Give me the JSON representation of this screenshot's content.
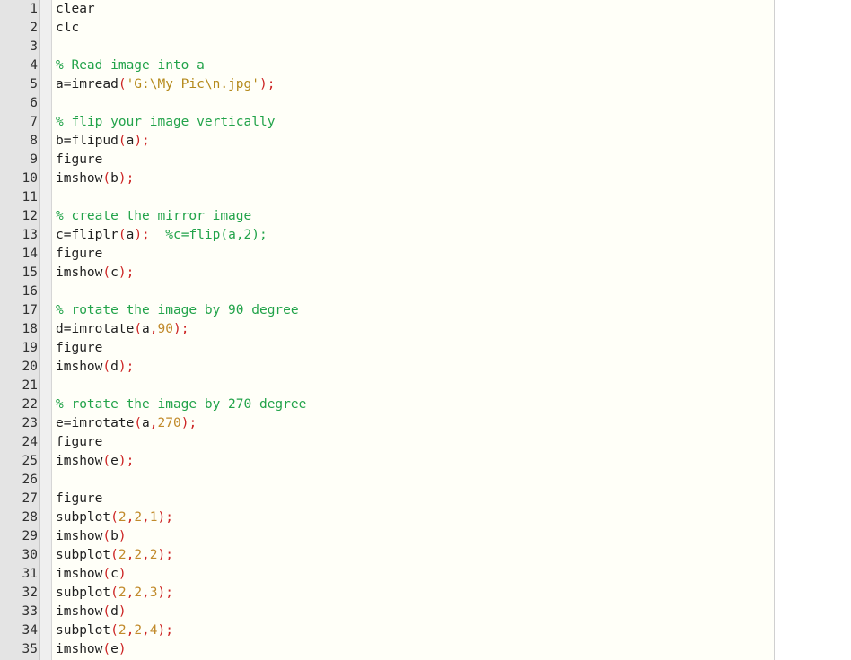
{
  "colors": {
    "default": "#1f1f1f",
    "comment": "#22a34a",
    "string": "#b58a1c",
    "number": "#c18a2b",
    "punctuation": "#cc2222",
    "gutter_bg": "#e4e4e4",
    "code_bg": "#fffff8"
  },
  "editor": {
    "lines": [
      {
        "n": "1",
        "tokens": [
          {
            "t": "clear",
            "c": "def"
          }
        ]
      },
      {
        "n": "2",
        "tokens": [
          {
            "t": "clc",
            "c": "def"
          }
        ]
      },
      {
        "n": "3",
        "tokens": []
      },
      {
        "n": "4",
        "tokens": [
          {
            "t": "% Read image into a",
            "c": "cmt"
          }
        ]
      },
      {
        "n": "5",
        "tokens": [
          {
            "t": "a=imread",
            "c": "def"
          },
          {
            "t": "(",
            "c": "punc"
          },
          {
            "t": "'G:\\My Pic\\n.jpg'",
            "c": "str"
          },
          {
            "t": ");",
            "c": "punc"
          }
        ]
      },
      {
        "n": "6",
        "tokens": []
      },
      {
        "n": "7",
        "tokens": [
          {
            "t": "% flip your image vertically",
            "c": "cmt"
          }
        ]
      },
      {
        "n": "8",
        "tokens": [
          {
            "t": "b=flipud",
            "c": "def"
          },
          {
            "t": "(",
            "c": "punc"
          },
          {
            "t": "a",
            "c": "def"
          },
          {
            "t": ");",
            "c": "punc"
          }
        ]
      },
      {
        "n": "9",
        "tokens": [
          {
            "t": "figure",
            "c": "def"
          }
        ]
      },
      {
        "n": "10",
        "tokens": [
          {
            "t": "imshow",
            "c": "def"
          },
          {
            "t": "(",
            "c": "punc"
          },
          {
            "t": "b",
            "c": "def"
          },
          {
            "t": ");",
            "c": "punc"
          }
        ]
      },
      {
        "n": "11",
        "tokens": []
      },
      {
        "n": "12",
        "tokens": [
          {
            "t": "% create the mirror image",
            "c": "cmt"
          }
        ]
      },
      {
        "n": "13",
        "tokens": [
          {
            "t": "c=fliplr",
            "c": "def"
          },
          {
            "t": "(",
            "c": "punc"
          },
          {
            "t": "a",
            "c": "def"
          },
          {
            "t": ");",
            "c": "punc"
          },
          {
            "t": "  ",
            "c": "def"
          },
          {
            "t": "%c=flip(a,2);",
            "c": "cmt"
          }
        ]
      },
      {
        "n": "14",
        "tokens": [
          {
            "t": "figure",
            "c": "def"
          }
        ]
      },
      {
        "n": "15",
        "tokens": [
          {
            "t": "imshow",
            "c": "def"
          },
          {
            "t": "(",
            "c": "punc"
          },
          {
            "t": "c",
            "c": "def"
          },
          {
            "t": ");",
            "c": "punc"
          }
        ]
      },
      {
        "n": "16",
        "tokens": []
      },
      {
        "n": "17",
        "tokens": [
          {
            "t": "% rotate the image by 90 degree",
            "c": "cmt"
          }
        ]
      },
      {
        "n": "18",
        "tokens": [
          {
            "t": "d=imrotate",
            "c": "def"
          },
          {
            "t": "(",
            "c": "punc"
          },
          {
            "t": "a",
            "c": "def"
          },
          {
            "t": ",",
            "c": "punc"
          },
          {
            "t": "90",
            "c": "num"
          },
          {
            "t": ");",
            "c": "punc"
          }
        ]
      },
      {
        "n": "19",
        "tokens": [
          {
            "t": "figure",
            "c": "def"
          }
        ]
      },
      {
        "n": "20",
        "tokens": [
          {
            "t": "imshow",
            "c": "def"
          },
          {
            "t": "(",
            "c": "punc"
          },
          {
            "t": "d",
            "c": "def"
          },
          {
            "t": ");",
            "c": "punc"
          }
        ]
      },
      {
        "n": "21",
        "tokens": []
      },
      {
        "n": "22",
        "tokens": [
          {
            "t": "% rotate the image by 270 degree",
            "c": "cmt"
          }
        ]
      },
      {
        "n": "23",
        "tokens": [
          {
            "t": "e=imrotate",
            "c": "def"
          },
          {
            "t": "(",
            "c": "punc"
          },
          {
            "t": "a",
            "c": "def"
          },
          {
            "t": ",",
            "c": "punc"
          },
          {
            "t": "270",
            "c": "num"
          },
          {
            "t": ");",
            "c": "punc"
          }
        ]
      },
      {
        "n": "24",
        "tokens": [
          {
            "t": "figure",
            "c": "def"
          }
        ]
      },
      {
        "n": "25",
        "tokens": [
          {
            "t": "imshow",
            "c": "def"
          },
          {
            "t": "(",
            "c": "punc"
          },
          {
            "t": "e",
            "c": "def"
          },
          {
            "t": ");",
            "c": "punc"
          }
        ]
      },
      {
        "n": "26",
        "tokens": []
      },
      {
        "n": "27",
        "tokens": [
          {
            "t": "figure",
            "c": "def"
          }
        ]
      },
      {
        "n": "28",
        "tokens": [
          {
            "t": "subplot",
            "c": "def"
          },
          {
            "t": "(",
            "c": "punc"
          },
          {
            "t": "2",
            "c": "num"
          },
          {
            "t": ",",
            "c": "punc"
          },
          {
            "t": "2",
            "c": "num"
          },
          {
            "t": ",",
            "c": "punc"
          },
          {
            "t": "1",
            "c": "num"
          },
          {
            "t": ");",
            "c": "punc"
          }
        ]
      },
      {
        "n": "29",
        "tokens": [
          {
            "t": "imshow",
            "c": "def"
          },
          {
            "t": "(",
            "c": "punc"
          },
          {
            "t": "b",
            "c": "def"
          },
          {
            "t": ")",
            "c": "punc"
          }
        ]
      },
      {
        "n": "30",
        "tokens": [
          {
            "t": "subplot",
            "c": "def"
          },
          {
            "t": "(",
            "c": "punc"
          },
          {
            "t": "2",
            "c": "num"
          },
          {
            "t": ",",
            "c": "punc"
          },
          {
            "t": "2",
            "c": "num"
          },
          {
            "t": ",",
            "c": "punc"
          },
          {
            "t": "2",
            "c": "num"
          },
          {
            "t": ");",
            "c": "punc"
          }
        ]
      },
      {
        "n": "31",
        "tokens": [
          {
            "t": "imshow",
            "c": "def"
          },
          {
            "t": "(",
            "c": "punc"
          },
          {
            "t": "c",
            "c": "def"
          },
          {
            "t": ")",
            "c": "punc"
          }
        ]
      },
      {
        "n": "32",
        "tokens": [
          {
            "t": "subplot",
            "c": "def"
          },
          {
            "t": "(",
            "c": "punc"
          },
          {
            "t": "2",
            "c": "num"
          },
          {
            "t": ",",
            "c": "punc"
          },
          {
            "t": "2",
            "c": "num"
          },
          {
            "t": ",",
            "c": "punc"
          },
          {
            "t": "3",
            "c": "num"
          },
          {
            "t": ");",
            "c": "punc"
          }
        ]
      },
      {
        "n": "33",
        "tokens": [
          {
            "t": "imshow",
            "c": "def"
          },
          {
            "t": "(",
            "c": "punc"
          },
          {
            "t": "d",
            "c": "def"
          },
          {
            "t": ")",
            "c": "punc"
          }
        ]
      },
      {
        "n": "34",
        "tokens": [
          {
            "t": "subplot",
            "c": "def"
          },
          {
            "t": "(",
            "c": "punc"
          },
          {
            "t": "2",
            "c": "num"
          },
          {
            "t": ",",
            "c": "punc"
          },
          {
            "t": "2",
            "c": "num"
          },
          {
            "t": ",",
            "c": "punc"
          },
          {
            "t": "4",
            "c": "num"
          },
          {
            "t": ");",
            "c": "punc"
          }
        ]
      },
      {
        "n": "35",
        "tokens": [
          {
            "t": "imshow",
            "c": "def"
          },
          {
            "t": "(",
            "c": "punc"
          },
          {
            "t": "e",
            "c": "def"
          },
          {
            "t": ")",
            "c": "punc"
          }
        ]
      }
    ]
  }
}
